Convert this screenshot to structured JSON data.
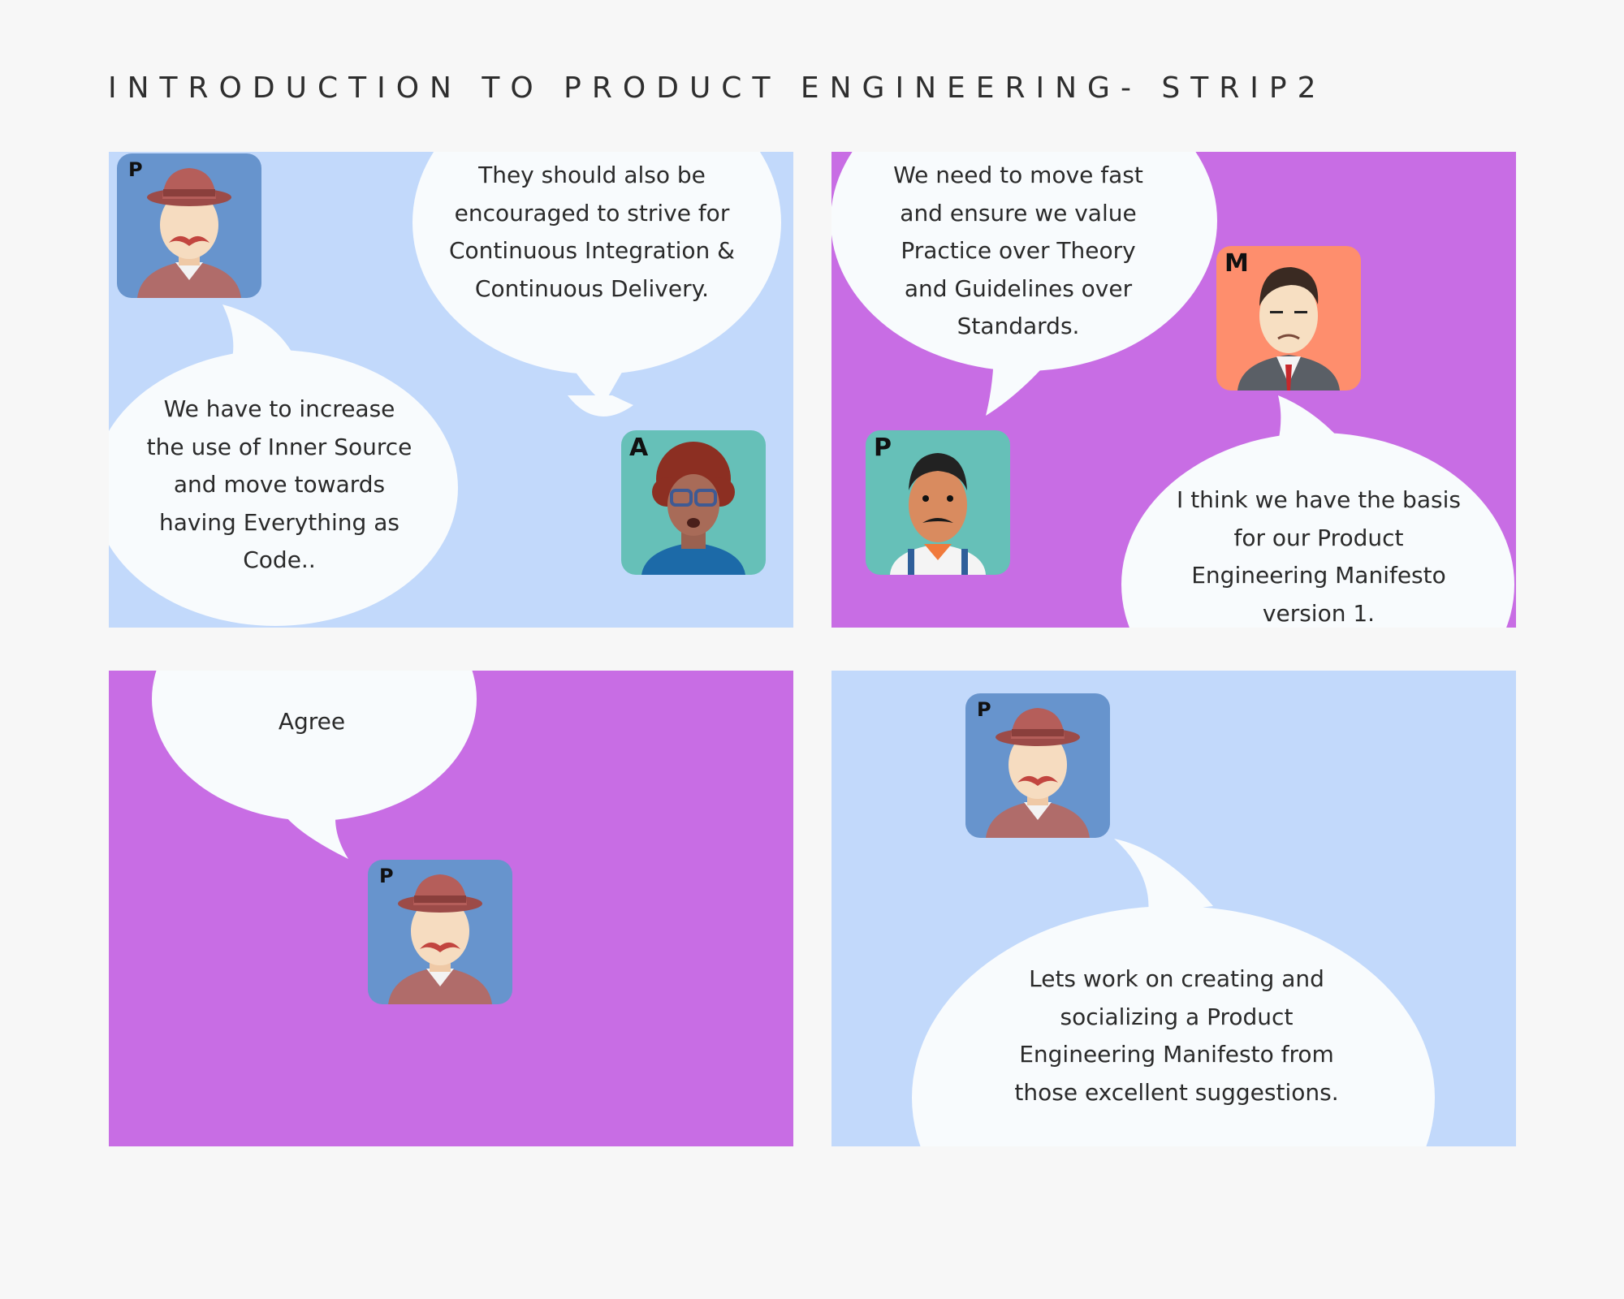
{
  "title": "INTRODUCTION TO PRODUCT ENGINEERING- STRIP2",
  "colors": {
    "page_bg": "#f7f7f7",
    "panel_light_blue": "#c2d9fb",
    "panel_purple": "#c86de4",
    "bubble": "#f8fbfd"
  },
  "panels": [
    {
      "characters": [
        {
          "badge": "P",
          "icon": "hat-mustache-man-avatar"
        },
        {
          "badge": "A",
          "icon": "curly-hair-woman-avatar"
        }
      ],
      "speech": [
        "We have to increase the use of Inner Source and move towards having Everything as Code..",
        "They should also be encouraged to strive for Continuous Integration & Continuous Delivery."
      ]
    },
    {
      "characters": [
        {
          "badge": "P",
          "icon": "mustache-man-suspenders-avatar"
        },
        {
          "badge": "M",
          "icon": "suited-man-avatar"
        }
      ],
      "speech": [
        "We need to move fast and ensure we value Practice over Theory and Guidelines over Standards.",
        "I think we have the basis for our Product Engineering Manifesto version 1."
      ]
    },
    {
      "characters": [
        {
          "badge": "P",
          "icon": "hat-mustache-man-avatar"
        }
      ],
      "speech": [
        "Agree"
      ]
    },
    {
      "characters": [
        {
          "badge": "P",
          "icon": "hat-mustache-man-avatar"
        }
      ],
      "speech": [
        "Lets work on creating and socializing a Product Engineering Manifesto from those excellent suggestions."
      ]
    }
  ]
}
